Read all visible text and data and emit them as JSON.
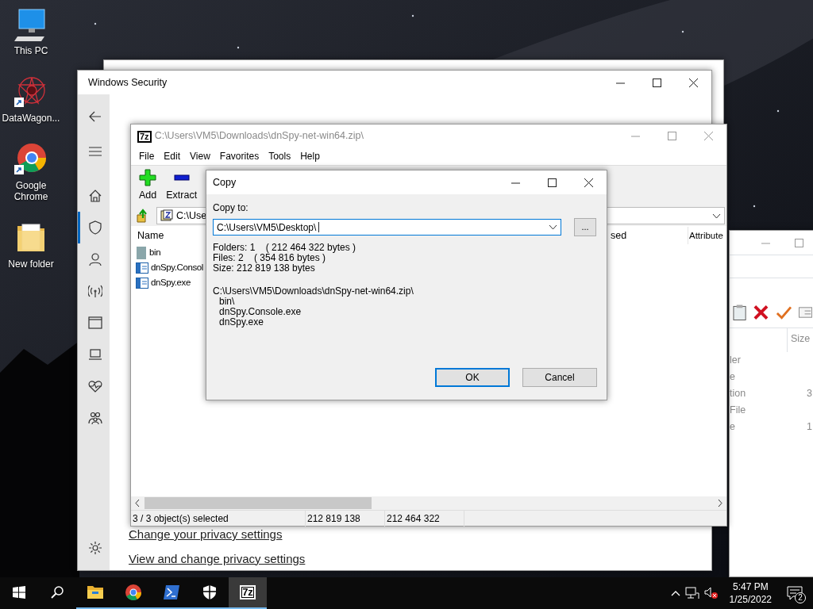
{
  "desktop_icons": [
    {
      "label": "This PC",
      "kind": "computer",
      "shortcut": false
    },
    {
      "label": "DataWagon...",
      "kind": "app",
      "shortcut": true
    },
    {
      "label": "Google Chrome",
      "kind": "browser",
      "shortcut": true
    },
    {
      "label": "New folder",
      "kind": "folder",
      "shortcut": false
    }
  ],
  "security_window": {
    "title": "Windows Security",
    "nav": [
      {
        "kind": "home",
        "selected": false
      },
      {
        "kind": "shield",
        "selected": true
      },
      {
        "kind": "person",
        "selected": false
      },
      {
        "kind": "wireless",
        "selected": false
      },
      {
        "kind": "browser",
        "selected": false
      },
      {
        "kind": "laptop",
        "selected": false
      },
      {
        "kind": "heart",
        "selected": false
      },
      {
        "kind": "family",
        "selected": false
      }
    ],
    "links": [
      "Change your privacy settings",
      "View and change privacy settings"
    ]
  },
  "archive_window": {
    "title": "C:\\Users\\VM5\\Downloads\\dnSpy-net-win64.zip\\",
    "logo": "7z",
    "menu": [
      "File",
      "Edit",
      "View",
      "Favorites",
      "Tools",
      "Help"
    ],
    "toolbar": [
      {
        "label": "Add",
        "kind": "add"
      },
      {
        "label": "Extract",
        "kind": "extract"
      }
    ],
    "address": "C:\\Use",
    "columns": [
      "Name",
      "sed",
      "Attribute"
    ],
    "files": [
      {
        "name": "bin",
        "kind": "folder"
      },
      {
        "name": "dnSpy.Consol",
        "kind": "exe"
      },
      {
        "name": "dnSpy.exe",
        "kind": "exe"
      }
    ],
    "status": [
      "3 / 3 object(s) selected",
      "212 819 138",
      "212 464 322"
    ]
  },
  "copy_dialog": {
    "title": "Copy",
    "label": "Copy to:",
    "path": "C:\\Users\\VM5\\Desktop\\",
    "browse": "...",
    "summary": [
      "Folders: 1    ( 212 464 322 bytes )",
      "Files: 2    ( 354 816 bytes )",
      "Size: 212 819 138 bytes"
    ],
    "source": {
      "path": "C:\\Users\\VM5\\Downloads\\dnSpy-net-win64.zip\\",
      "children": [
        "bin\\",
        "dnSpy.Console.exe",
        "dnSpy.exe"
      ]
    },
    "buttons": [
      {
        "label": "OK",
        "default": true
      },
      {
        "label": "Cancel",
        "default": false
      }
    ]
  },
  "right_window": {
    "size_heading": "Size",
    "rows": [
      {
        "column_1": "ler"
      },
      {
        "column_1": "e"
      },
      {
        "column_1": "tion",
        "size": "3"
      },
      {
        "column_1": "File"
      },
      {
        "column_1": "e",
        "size": "1"
      }
    ]
  },
  "taskbar": {
    "apps": [
      {
        "kind": "explorer",
        "active": false
      },
      {
        "kind": "chrome",
        "active": false
      },
      {
        "kind": "powershell",
        "active": false
      },
      {
        "kind": "security",
        "active": false
      },
      {
        "kind": "archiver",
        "active": true,
        "label": "7z"
      }
    ],
    "time": "5:47 PM",
    "date": "1/25/2022",
    "notifications": "2"
  }
}
